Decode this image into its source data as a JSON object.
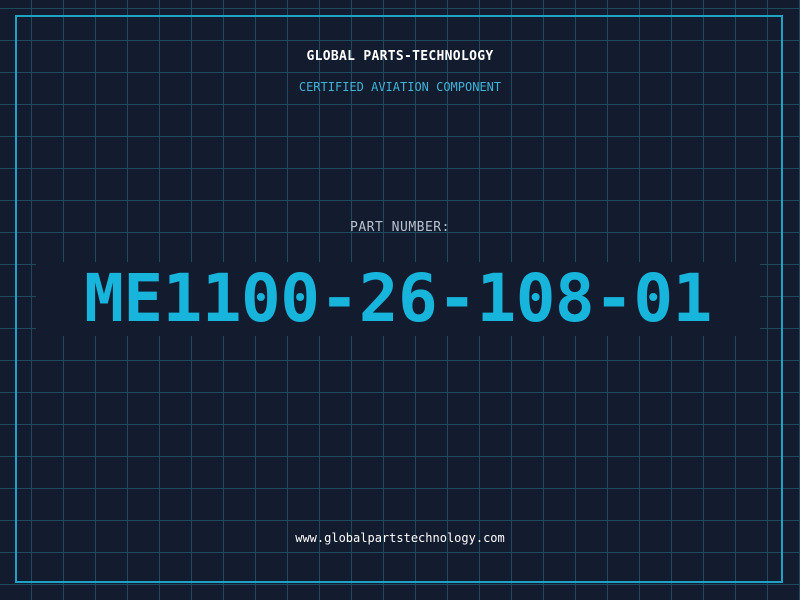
{
  "header": {
    "company": "GLOBAL PARTS-TECHNOLOGY",
    "subtitle": "CERTIFIED AVIATION COMPONENT"
  },
  "part": {
    "label": "PART NUMBER:",
    "number": "ME1100-26-108-01"
  },
  "footer": {
    "website": "www.globalpartstechnology.com"
  },
  "colors": {
    "background": "#131b2e",
    "grid": "#1e4a5e",
    "border": "#1ea2c6",
    "accent": "#17b4dc"
  }
}
